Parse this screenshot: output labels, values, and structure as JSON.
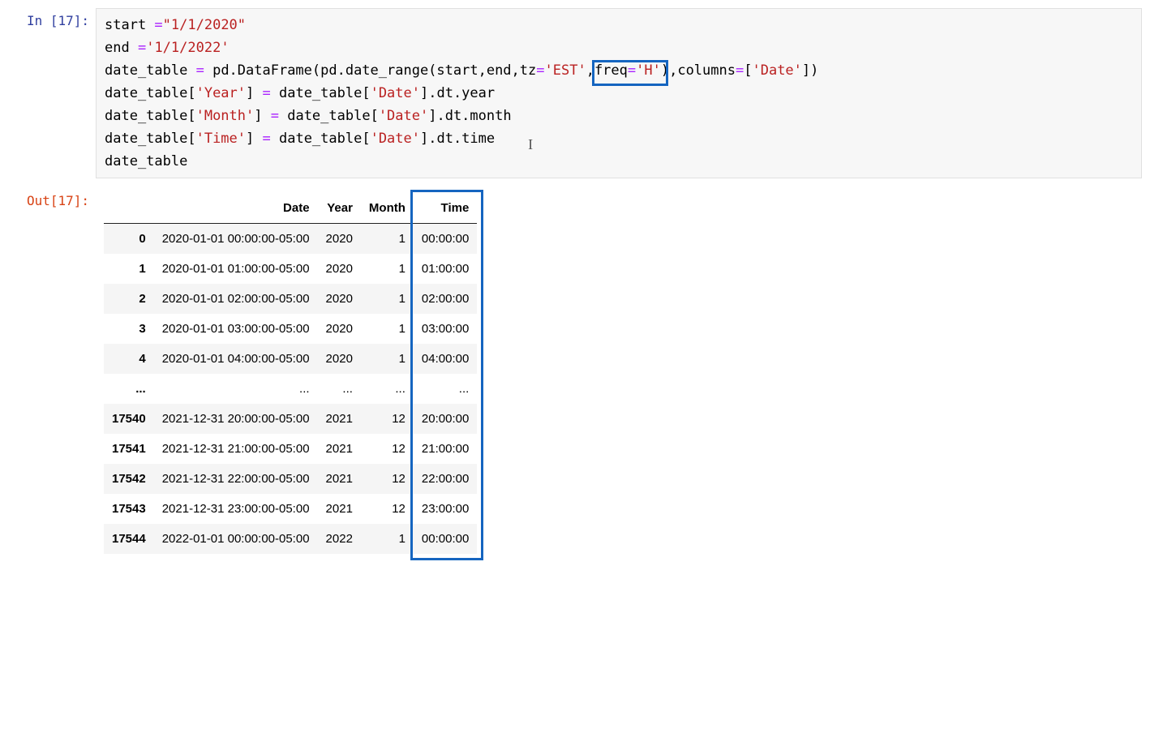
{
  "prompt_in": "In [17]:",
  "prompt_out": "Out[17]:",
  "code": {
    "l1a": "start ",
    "l1b": "=",
    "l1c": "\"1/1/2020\"",
    "l2a": "end ",
    "l2b": "=",
    "l2c": "'1/1/2022'",
    "l3a": "date_table ",
    "l3b": "=",
    "l3c": " pd.DataFrame(pd.date_range(start,end,tz",
    "l3d": "=",
    "l3e": "'EST'",
    "l3f": ",",
    "l3g": "freq",
    "l3h": "=",
    "l3i": "'H'",
    "l3j": "),columns",
    "l3k": "=",
    "l3l": "[",
    "l3m": "'Date'",
    "l3n": "])",
    "l4a": "date_table[",
    "l4b": "'Year'",
    "l4c": "] ",
    "l4d": "=",
    "l4e": " date_table[",
    "l4f": "'Date'",
    "l4g": "].dt.year",
    "l5a": "date_table[",
    "l5b": "'Month'",
    "l5c": "] ",
    "l5d": "=",
    "l5e": " date_table[",
    "l5f": "'Date'",
    "l5g": "].dt.month",
    "l6a": "date_table[",
    "l6b": "'Time'",
    "l6c": "] ",
    "l6d": "=",
    "l6e": " date_table[",
    "l6f": "'Date'",
    "l6g": "].dt.time",
    "l7": "date_table"
  },
  "caret": "I",
  "table": {
    "columns": [
      "Date",
      "Year",
      "Month",
      "Time"
    ],
    "rows": [
      {
        "idx": "0",
        "Date": "2020-01-01 00:00:00-05:00",
        "Year": "2020",
        "Month": "1",
        "Time": "00:00:00"
      },
      {
        "idx": "1",
        "Date": "2020-01-01 01:00:00-05:00",
        "Year": "2020",
        "Month": "1",
        "Time": "01:00:00"
      },
      {
        "idx": "2",
        "Date": "2020-01-01 02:00:00-05:00",
        "Year": "2020",
        "Month": "1",
        "Time": "02:00:00"
      },
      {
        "idx": "3",
        "Date": "2020-01-01 03:00:00-05:00",
        "Year": "2020",
        "Month": "1",
        "Time": "03:00:00"
      },
      {
        "idx": "4",
        "Date": "2020-01-01 04:00:00-05:00",
        "Year": "2020",
        "Month": "1",
        "Time": "04:00:00"
      },
      {
        "idx": "...",
        "Date": "...",
        "Year": "...",
        "Month": "...",
        "Time": "..."
      },
      {
        "idx": "17540",
        "Date": "2021-12-31 20:00:00-05:00",
        "Year": "2021",
        "Month": "12",
        "Time": "20:00:00"
      },
      {
        "idx": "17541",
        "Date": "2021-12-31 21:00:00-05:00",
        "Year": "2021",
        "Month": "12",
        "Time": "21:00:00"
      },
      {
        "idx": "17542",
        "Date": "2021-12-31 22:00:00-05:00",
        "Year": "2021",
        "Month": "12",
        "Time": "22:00:00"
      },
      {
        "idx": "17543",
        "Date": "2021-12-31 23:00:00-05:00",
        "Year": "2021",
        "Month": "12",
        "Time": "23:00:00"
      },
      {
        "idx": "17544",
        "Date": "2022-01-01 00:00:00-05:00",
        "Year": "2022",
        "Month": "1",
        "Time": "00:00:00"
      }
    ]
  }
}
